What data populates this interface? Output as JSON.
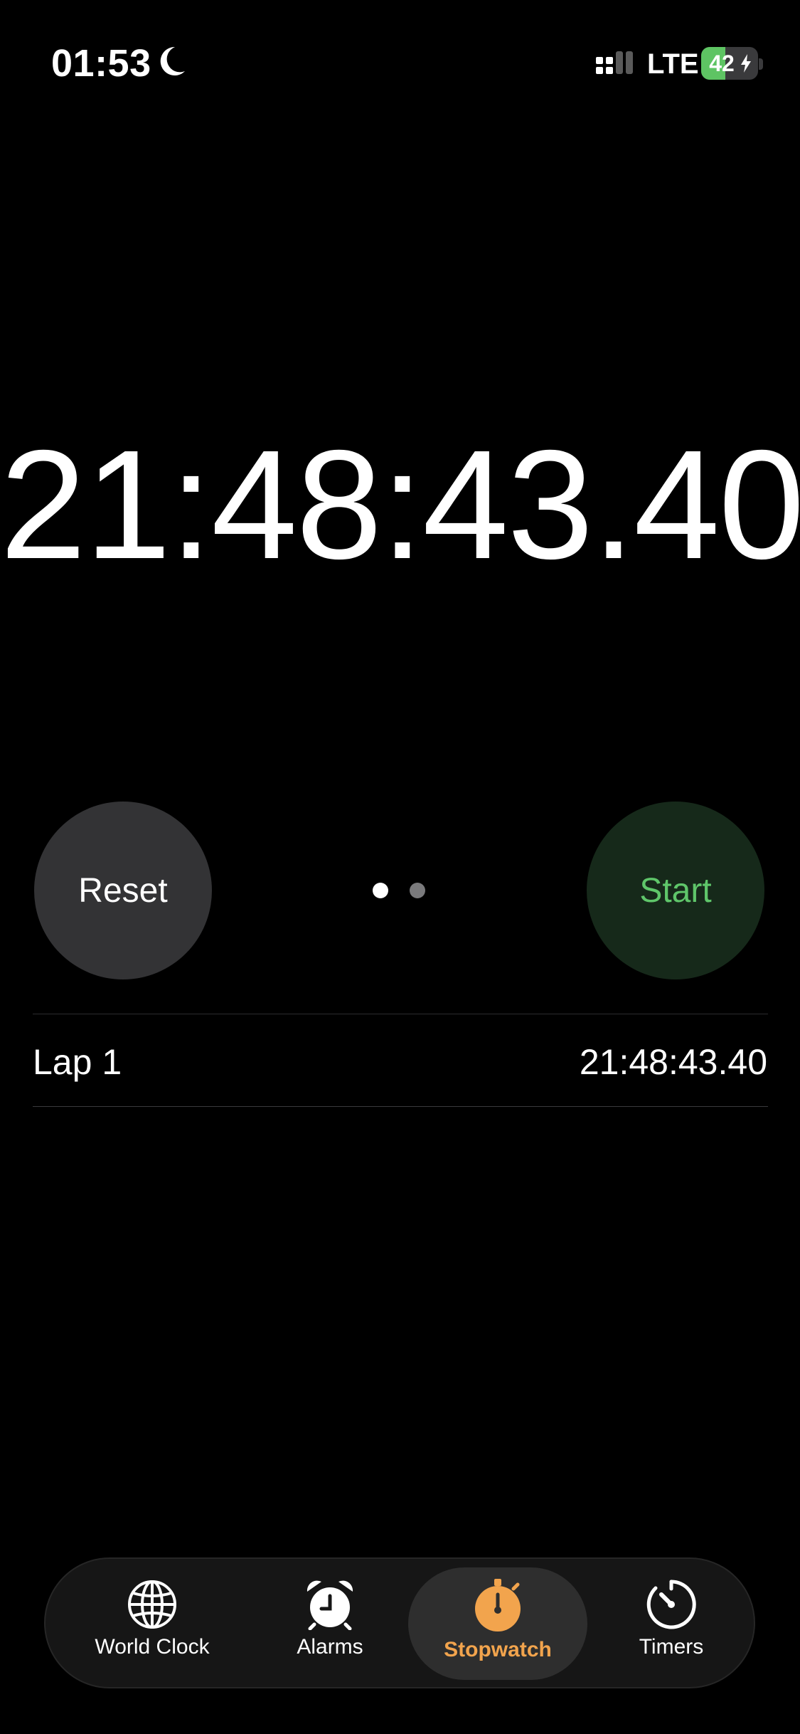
{
  "status_bar": {
    "time": "01:53",
    "network": "LTE",
    "battery_level": "42",
    "battery_fraction": 0.42,
    "icons": [
      "moon-icon",
      "signal-icon",
      "battery-icon",
      "bolt-icon"
    ]
  },
  "stopwatch": {
    "display_time": "21:48:43.40"
  },
  "controls": {
    "reset_label": "Reset",
    "start_label": "Start",
    "page_count": 2,
    "active_page": 1
  },
  "laps": [
    {
      "label": "Lap 1",
      "time": "21:48:43.40"
    }
  ],
  "tab_bar": {
    "tabs": [
      {
        "label": "World Clock",
        "icon": "globe-icon",
        "selected": false
      },
      {
        "label": "Alarms",
        "icon": "alarm-clock-icon",
        "selected": false
      },
      {
        "label": "Stopwatch",
        "icon": "stopwatch-icon",
        "selected": true
      },
      {
        "label": "Timers",
        "icon": "timer-icon",
        "selected": false
      }
    ]
  },
  "colors": {
    "background": "#000000",
    "accent": "#f2a44d",
    "start_text": "#5fc66a",
    "start_bg": "#16291a",
    "reset_bg": "#333335",
    "battery_green": "#5ec463"
  }
}
